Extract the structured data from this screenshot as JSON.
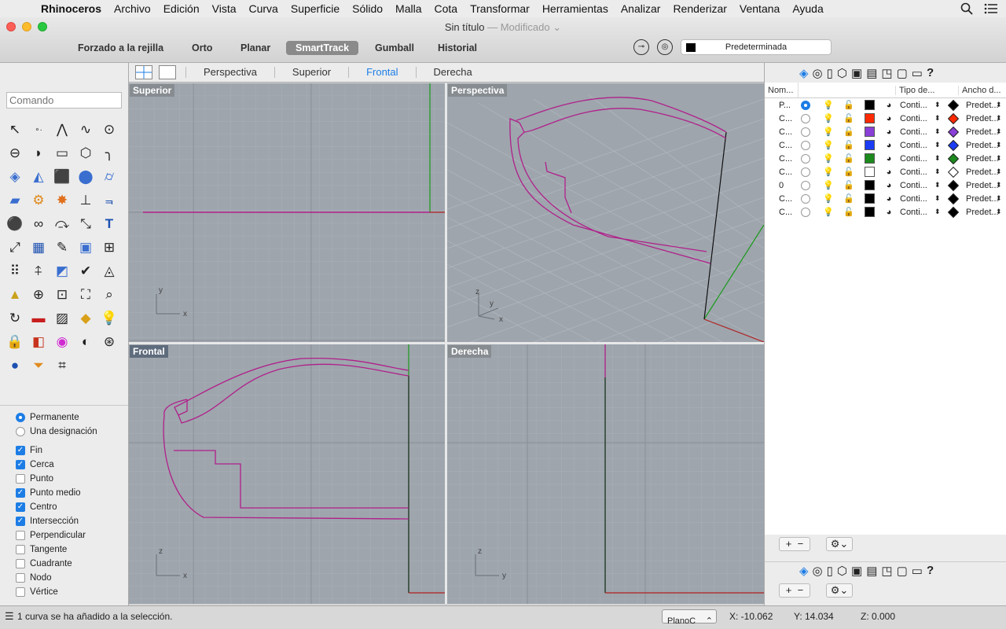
{
  "menubar": {
    "app_name": "Rhinoceros",
    "items": [
      "Archivo",
      "Edición",
      "Vista",
      "Curva",
      "Superficie",
      "Sólido",
      "Malla",
      "Cota",
      "Transformar",
      "Herramientas",
      "Analizar",
      "Renderizar",
      "Ventana",
      "Ayuda"
    ]
  },
  "window": {
    "title": "Sin título",
    "modified": "— Modificado"
  },
  "toolbar": {
    "grid_snap": "Forzado a la rejilla",
    "ortho": "Orto",
    "planar": "Planar",
    "smarttrack": "SmartTrack",
    "gumball": "Gumball",
    "history": "Historial",
    "current_layer": "Predeterminada"
  },
  "command": {
    "placeholder": "Comando"
  },
  "view_tabs": [
    "Perspectiva",
    "Superior",
    "Frontal",
    "Derecha"
  ],
  "active_tab": "Frontal",
  "viewports": {
    "top": "Superior",
    "perspective": "Perspectiva",
    "front": "Frontal",
    "right": "Derecha"
  },
  "axes": {
    "x": "x",
    "y": "y",
    "z": "z"
  },
  "osnap": {
    "radios": [
      {
        "label": "Permanente",
        "on": true
      },
      {
        "label": "Una designación",
        "on": false
      }
    ],
    "checks": [
      {
        "label": "Fin",
        "on": true
      },
      {
        "label": "Cerca",
        "on": true
      },
      {
        "label": "Punto",
        "on": false
      },
      {
        "label": "Punto medio",
        "on": true
      },
      {
        "label": "Centro",
        "on": true
      },
      {
        "label": "Intersección",
        "on": true
      },
      {
        "label": "Perpendicular",
        "on": false
      },
      {
        "label": "Tangente",
        "on": false
      },
      {
        "label": "Cuadrante",
        "on": false
      },
      {
        "label": "Nodo",
        "on": false
      },
      {
        "label": "Vértice",
        "on": false
      }
    ]
  },
  "layers": {
    "headers": {
      "name": "Nom...",
      "linetype": "Tipo de...",
      "width": "Ancho d..."
    },
    "rows": [
      {
        "name": "P...",
        "current": true,
        "color": "#000000",
        "linetype": "Conti...",
        "print": "#000000",
        "width": "Predet..."
      },
      {
        "name": "C...",
        "current": false,
        "color": "#ff2a00",
        "linetype": "Conti...",
        "print": "#ff2a00",
        "width": "Predet..."
      },
      {
        "name": "C...",
        "current": false,
        "color": "#8a3fd6",
        "linetype": "Conti...",
        "print": "#8a3fd6",
        "width": "Predet..."
      },
      {
        "name": "C...",
        "current": false,
        "color": "#1a3cf5",
        "linetype": "Conti...",
        "print": "#1a3cf5",
        "width": "Predet..."
      },
      {
        "name": "C...",
        "current": false,
        "color": "#1c8a1c",
        "linetype": "Conti...",
        "print": "#1c8a1c",
        "width": "Predet..."
      },
      {
        "name": "C...",
        "current": false,
        "color": "#ffffff",
        "linetype": "Conti...",
        "print": "#ffffff",
        "width": "Predet..."
      },
      {
        "name": "0",
        "current": false,
        "color": "#000000",
        "linetype": "Conti...",
        "print": "#000000",
        "width": "Predet..."
      },
      {
        "name": "C...",
        "current": false,
        "color": "#000000",
        "linetype": "Conti...",
        "print": "#000000",
        "width": "Predet..."
      },
      {
        "name": "C...",
        "current": false,
        "color": "#000000",
        "linetype": "Conti...",
        "print": "#000000",
        "width": "Predet..."
      }
    ]
  },
  "status": {
    "message": "1 curva se ha añadido a la selección.",
    "plane": "PlanoC",
    "x": "X: -10.062",
    "y": "Y: 14.034",
    "z": "Z: 0.000"
  }
}
